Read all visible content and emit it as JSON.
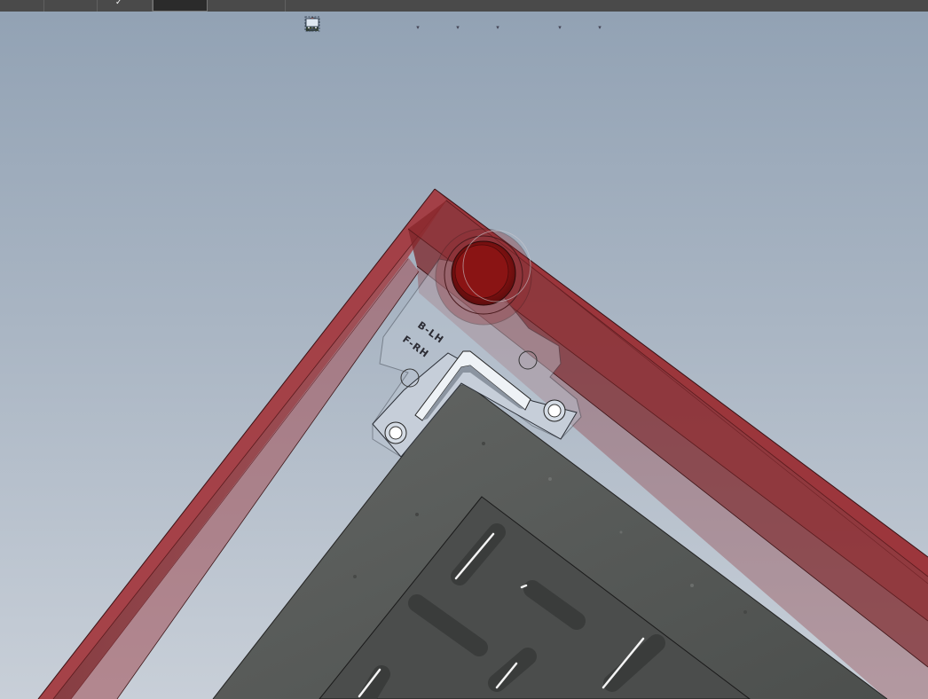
{
  "topbar": {
    "active_tab_check": "✓"
  },
  "heads_up_toolbar": {
    "tools": [
      {
        "icon": "zoom-to-fit-icon"
      },
      {
        "icon": "zoom-to-area-icon"
      },
      {
        "icon": "previous-view-icon"
      },
      {
        "icon": "section-view-icon"
      },
      {
        "icon": "view-orientation-icon"
      },
      {
        "icon": "display-style-icon"
      },
      {
        "icon": "hide-show-items-icon"
      },
      {
        "icon": "edit-appearance-icon"
      },
      {
        "icon": "apply-scene-icon"
      },
      {
        "icon": "view-settings-icon"
      }
    ]
  },
  "model": {
    "plate_label_line1": "B-LH",
    "plate_label_line2": "F-RH",
    "colors": {
      "frame": "#8f2f33",
      "frame_highlight": "#b04a4e",
      "boss": "#8a1414",
      "plate": "#b9c4d2",
      "panel": "#595c5a",
      "inner_panel": "#4e504f",
      "background_top": "#92a2b4",
      "background_bottom": "#c8cfd8"
    }
  }
}
